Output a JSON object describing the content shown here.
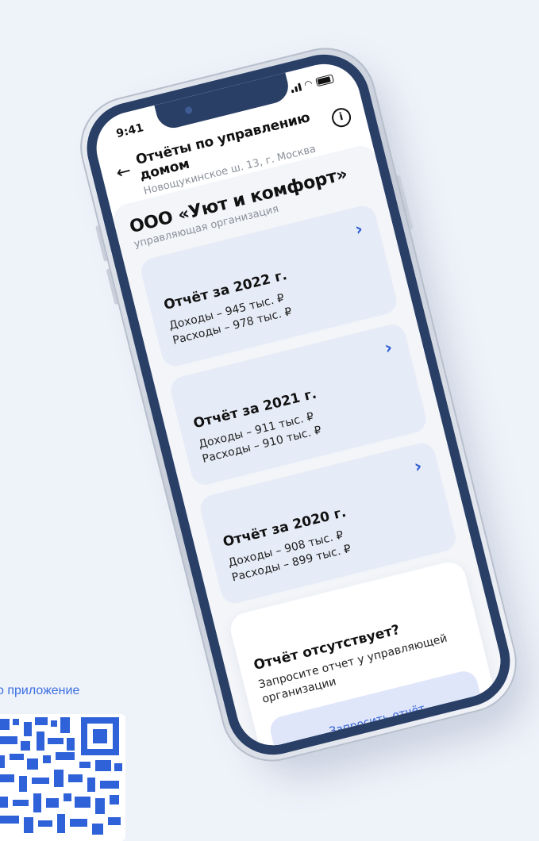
{
  "promo": {
    "text": "о приложение"
  },
  "status_bar": {
    "time": "9:41"
  },
  "header": {
    "title": "Отчёты по управлению домом",
    "subtitle": "Новощукинское ш. 13, г. Москва"
  },
  "organization": {
    "name": "ООО «Уют и комфорт»",
    "role": "управляющая организация"
  },
  "reports": [
    {
      "title": "Отчёт за 2022 г.",
      "income": "Доходы – 945 тыс. ₽",
      "expenses": "Расходы – 978 тыс. ₽"
    },
    {
      "title": "Отчёт за 2021 г.",
      "income": "Доходы – 911 тыс. ₽",
      "expenses": "Расходы – 910 тыс. ₽"
    },
    {
      "title": "Отчёт за 2020 г.",
      "income": "Доходы – 908 тыс. ₽",
      "expenses": "Расходы – 899 тыс. ₽"
    }
  ],
  "missing": {
    "title": "Отчёт отсутствует?",
    "text": "Запросите отчет у управляющей организации",
    "button_label": "Запросить отчёт"
  },
  "colors": {
    "accent": "#2f5fd7",
    "bezel": "#2a3f66",
    "card_bg": "#e6ecf7",
    "button_bg": "#dfe6fa"
  }
}
